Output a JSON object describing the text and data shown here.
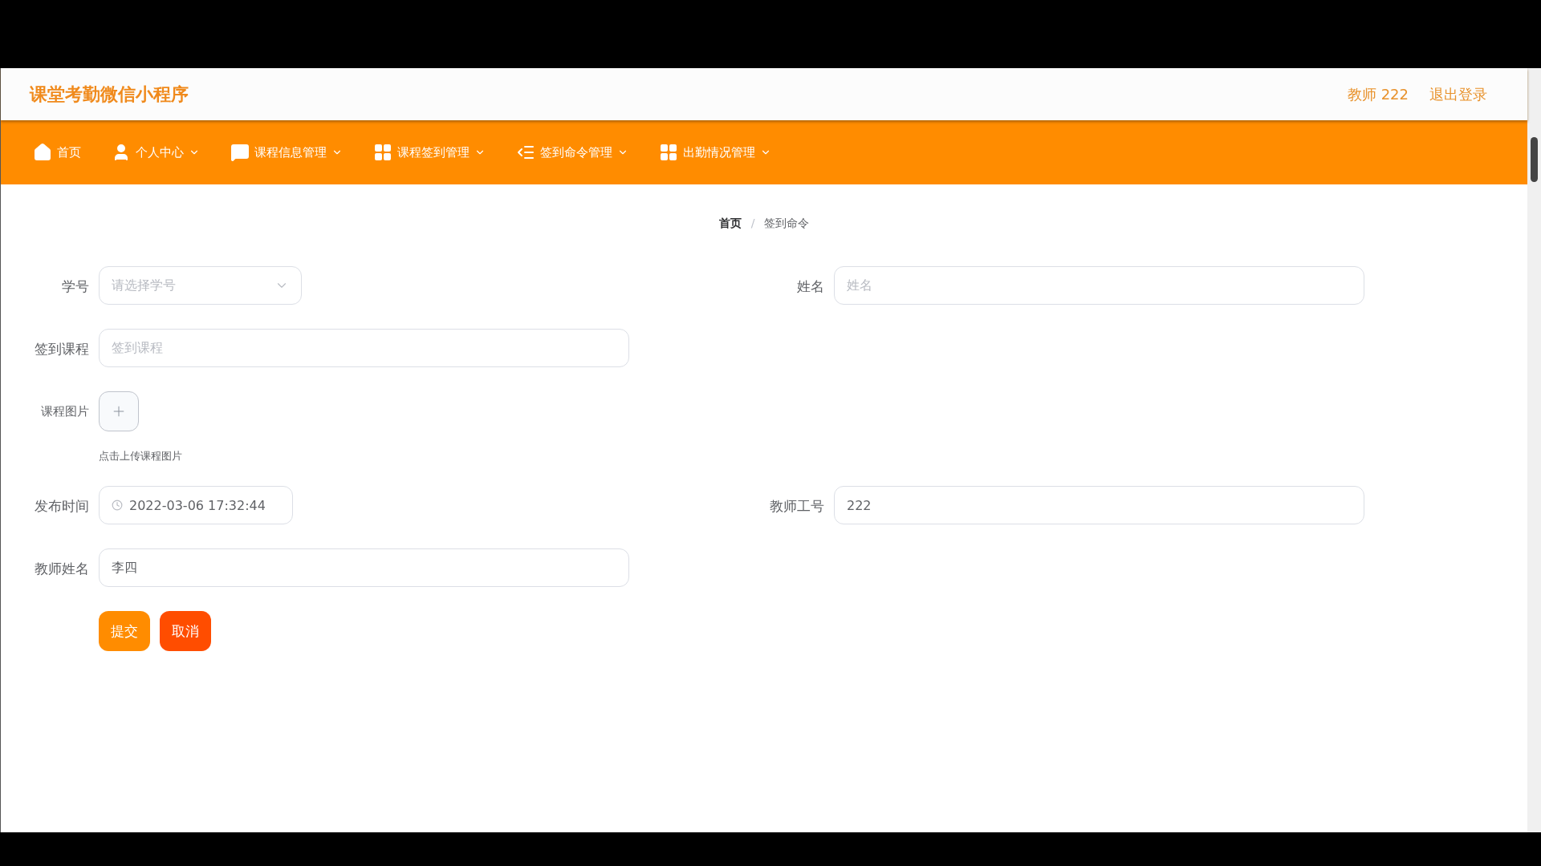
{
  "header": {
    "title": "课堂考勤微信小程序",
    "user": "教师 222",
    "logout": "退出登录"
  },
  "nav": [
    {
      "label": "首页",
      "dropdown": false
    },
    {
      "label": "个人中心",
      "dropdown": true
    },
    {
      "label": "课程信息管理",
      "dropdown": true
    },
    {
      "label": "课程签到管理",
      "dropdown": true
    },
    {
      "label": "签到命令管理",
      "dropdown": true
    },
    {
      "label": "出勤情况管理",
      "dropdown": true
    }
  ],
  "breadcrumb": {
    "separator": "/",
    "items": [
      "首页",
      "签到命令"
    ]
  },
  "form": {
    "rows": [
      [
        {
          "label": "学号",
          "kind": "select",
          "placeholder": "请选择学号"
        },
        {
          "label": "姓名",
          "kind": "text",
          "placeholder": "姓名"
        }
      ],
      [
        {
          "label": "签到课程",
          "kind": "text",
          "placeholder": "签到课程"
        }
      ],
      [
        {
          "label": "课程图片",
          "kind": "upload",
          "hint": "点击上传课程图片"
        }
      ],
      [
        {
          "label": "发布时间",
          "kind": "datetime",
          "value": "2022-03-06 17:32:44"
        },
        {
          "label": "教师工号",
          "kind": "text",
          "value": "222"
        }
      ],
      [
        {
          "label": "教师姓名",
          "kind": "text",
          "value": "李四"
        }
      ]
    ],
    "buttons": [
      {
        "label": "提交",
        "kind": "submit"
      },
      {
        "label": "取消",
        "kind": "cancel"
      }
    ]
  }
}
